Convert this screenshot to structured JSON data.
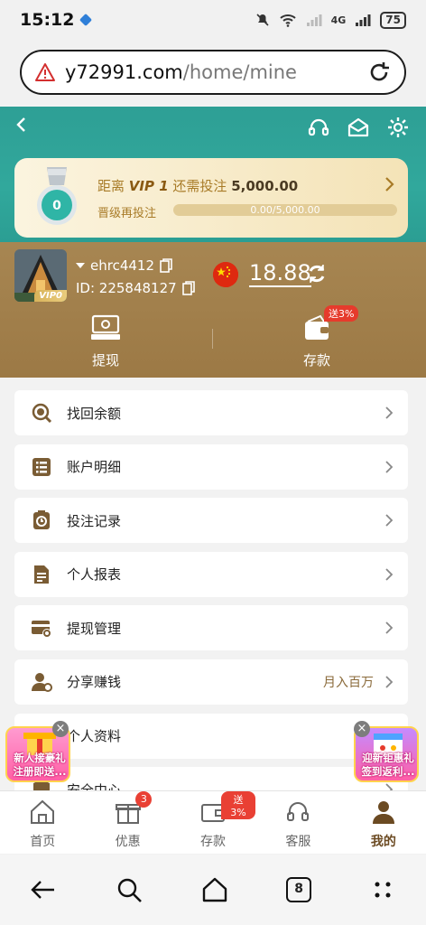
{
  "status_bar": {
    "time": "15:12",
    "network": "4G",
    "battery": "75"
  },
  "browser": {
    "url_domain": "y72991.com",
    "url_path": "/home/mine"
  },
  "vip": {
    "prefix": "距离",
    "level": "VIP 1",
    "middle": "还需投注",
    "amount": "5,000.00",
    "upgrade_label": "晋级再投注",
    "progress_text": "0.00/5,000.00",
    "progress": 0,
    "medal_level": "0"
  },
  "profile": {
    "avatar_badge": "VIP0",
    "username": "ehrc4412",
    "id_text": "ID: 225848127",
    "balance": "18.88"
  },
  "actions": {
    "withdraw_label": "提现",
    "deposit_label": "存款",
    "deposit_tag": "送3%"
  },
  "menu": [
    {
      "label": "找回余额",
      "extra": ""
    },
    {
      "label": "账户明细",
      "extra": ""
    },
    {
      "label": "投注记录",
      "extra": ""
    },
    {
      "label": "个人报表",
      "extra": ""
    },
    {
      "label": "提现管理",
      "extra": ""
    },
    {
      "label": "分享赚钱",
      "extra": "月入百万"
    },
    {
      "label": "个人资料",
      "extra": ""
    },
    {
      "label": "安全中心",
      "extra": ""
    }
  ],
  "promos": {
    "left_line1": "新人接豪礼",
    "left_line2": "注册即送...",
    "right_line1": "迎新钜惠礼",
    "right_line2": "签到返利..."
  },
  "tabs": [
    {
      "label": "首页"
    },
    {
      "label": "优惠",
      "badge": "3"
    },
    {
      "label": "存款",
      "tag": "送3%"
    },
    {
      "label": "客服"
    },
    {
      "label": "我的"
    }
  ],
  "android_nav": {
    "tab_count": "8"
  },
  "colors": {
    "teal": "#2e9f95",
    "brown": "#a78652",
    "accent_red": "#e63b2c",
    "gold": "#a87b27"
  }
}
